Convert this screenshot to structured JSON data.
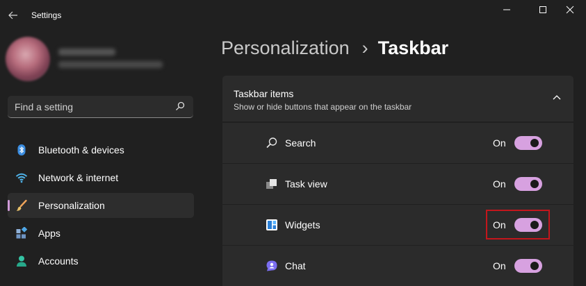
{
  "window": {
    "title": "Settings",
    "controls": [
      "minimize-icon",
      "maximize-icon",
      "close-icon"
    ]
  },
  "sidebar": {
    "search": {
      "placeholder": "Find a setting",
      "value": ""
    },
    "items": [
      {
        "label": "Bluetooth & devices",
        "icon": "bluetooth-icon",
        "active": false
      },
      {
        "label": "Network & internet",
        "icon": "wifi-icon",
        "active": false
      },
      {
        "label": "Personalization",
        "icon": "brush-icon",
        "active": true
      },
      {
        "label": "Apps",
        "icon": "apps-icon",
        "active": false
      },
      {
        "label": "Accounts",
        "icon": "person-icon",
        "active": false
      }
    ]
  },
  "main": {
    "breadcrumb": {
      "parent": "Personalization",
      "separator": "›",
      "current": "Taskbar"
    },
    "section": {
      "title": "Taskbar items",
      "subtitle": "Show or hide buttons that appear on the taskbar",
      "rows": [
        {
          "label": "Search",
          "state": "On",
          "toggle_on": true,
          "icon": "search-icon"
        },
        {
          "label": "Task view",
          "state": "On",
          "toggle_on": true,
          "icon": "task-view-icon"
        },
        {
          "label": "Widgets",
          "state": "On",
          "toggle_on": true,
          "icon": "widgets-icon"
        },
        {
          "label": "Chat",
          "state": "On",
          "toggle_on": true,
          "icon": "chat-icon"
        }
      ]
    }
  },
  "colors": {
    "background": "#202020",
    "card": "#2b2b2b",
    "accent": "#d7a1e0",
    "highlight_box": "#c4161c"
  }
}
